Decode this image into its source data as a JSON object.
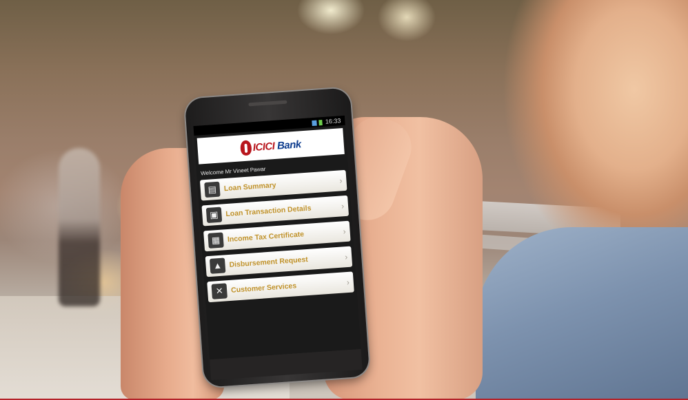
{
  "status_bar": {
    "time": "16:33"
  },
  "app": {
    "logo": {
      "brand": "ICICI",
      "word": "Bank"
    },
    "welcome": "Welcome Mr Vineet Pawar",
    "menu": [
      {
        "label": "Loan Summary",
        "icon": "clipboard-icon"
      },
      {
        "label": "Loan Transaction Details",
        "icon": "document-info-icon"
      },
      {
        "label": "Income Tax Certificate",
        "icon": "certificate-icon"
      },
      {
        "label": "Disbursement Request",
        "icon": "chart-icon"
      },
      {
        "label": "Customer Services",
        "icon": "tools-icon"
      }
    ]
  },
  "colors": {
    "brand_blue": "#0c3b8d",
    "brand_red": "#b8161d",
    "menu_label": "#c0922a"
  }
}
